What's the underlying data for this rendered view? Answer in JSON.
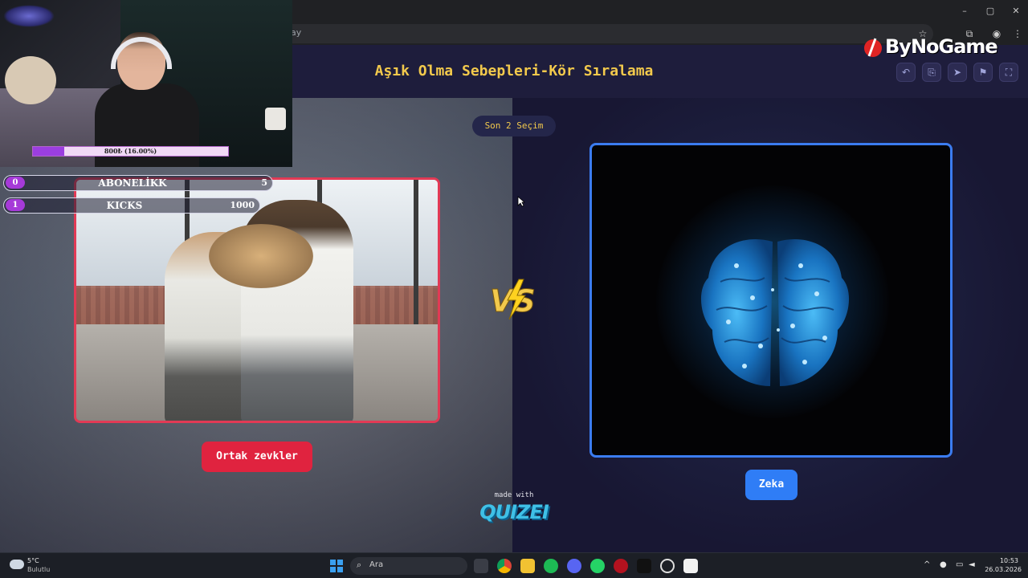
{
  "browser": {
    "address_fragment": "ay",
    "window_controls": [
      "–",
      "▢",
      "✕"
    ],
    "toolbar_icons": [
      "star-icon",
      "extension-icon",
      "profile-icon",
      "menu-icon"
    ]
  },
  "quiz": {
    "title": "Aşık Olma Sebepleri-Kör Sıralama",
    "round_pill": "Son 2 Seçim",
    "left_choice": "Ortak zevkler",
    "right_choice": "Zeka",
    "made_with": "made with",
    "brand": "QUIZEI",
    "header_buttons": [
      "undo-icon",
      "share-icon",
      "send-icon",
      "flag-icon",
      "fullscreen-icon"
    ]
  },
  "overlay": {
    "logo_text": "ByNoGame",
    "goal_progress_text": "800₺ (16.00%)",
    "goal_progress_fraction": 0.16,
    "stats": [
      {
        "index": "0",
        "name": "ABONELİKK",
        "value": "5"
      },
      {
        "index": "1",
        "name": "KICKS",
        "value": "1000"
      }
    ]
  },
  "taskbar": {
    "weather_temp": "5°C",
    "weather_cond": "Bulutlu",
    "search_placeholder": "Ara",
    "time": "10:53",
    "date": "26.03.2026",
    "apps": [
      "windows-start-icon",
      "task-view-icon",
      "chrome-icon",
      "file-explorer-icon",
      "spotify-icon",
      "discord-icon",
      "whatsapp-icon",
      "app-red-icon",
      "app-m-icon",
      "app-circle-icon",
      "capcut-icon"
    ],
    "colors": {
      "spotify": "#1db954",
      "discord": "#5865f2",
      "whatsapp": "#25d366"
    }
  },
  "colors": {
    "title": "#f2c94c",
    "left_accent": "#e0233f",
    "right_accent": "#2f7df6"
  }
}
